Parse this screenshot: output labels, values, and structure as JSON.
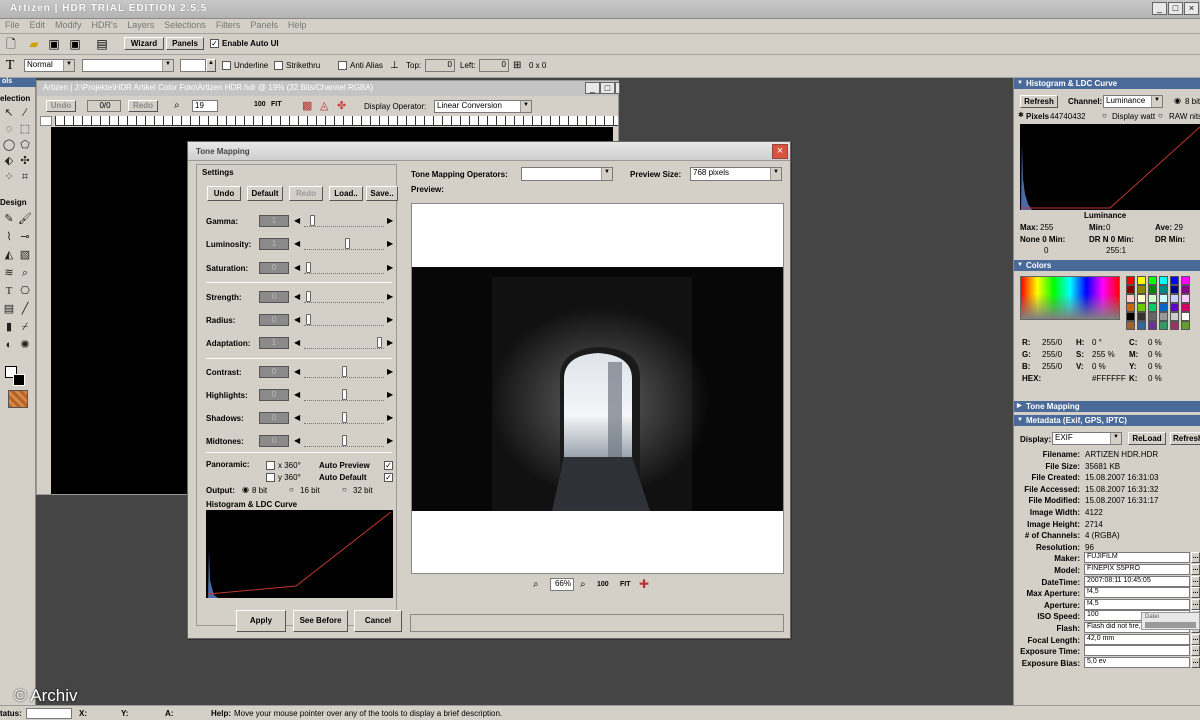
{
  "app": {
    "title": "Artizen | HDR TRIAL EDITION 2.5.5"
  },
  "menu": [
    "File",
    "Edit",
    "Modify",
    "HDR's",
    "Layers",
    "Selections",
    "Filters",
    "Panels",
    "Help"
  ],
  "toolbar1": {
    "wizard": "Wizard",
    "panels": "Panels",
    "enable_auto_ui": "Enable Auto UI"
  },
  "toolbar2": {
    "font_style": "Normal",
    "font_name": "",
    "font_size": "",
    "underline": "Underline",
    "strikethru": "Strikethru",
    "anti_alias": "Anti Alias",
    "top_label": "Top:",
    "top_value": "0",
    "left_label": "Left:",
    "left_value": "0",
    "size_readout": "0 x 0"
  },
  "toolbox": {
    "title_fragment": "ols",
    "selection": "election",
    "design": "Design"
  },
  "document": {
    "title": "Artizen | J:\\Projekte\\HDR Artikel Color Foto\\Artizen HDR.hdr @ 19% (32 Bits/Channel RGBA)",
    "undo": "Undo",
    "ratio": "0/0",
    "redo": "Redo",
    "zoom": "19",
    "btn_100": "100",
    "btn_fit": "FIT",
    "display_operator_label": "Display Operator:",
    "display_operator": "Linear Conversion"
  },
  "dialog": {
    "title": "Tone Mapping",
    "settings_label": "Settings",
    "buttons": {
      "undo": "Undo",
      "default": "Default",
      "redo": "Redo",
      "load": "Load..",
      "save": "Save.."
    },
    "sliders": [
      {
        "name": "Gamma:",
        "value": "1",
        "pos": 0.08
      },
      {
        "name": "Luminosity:",
        "value": "1",
        "pos": 0.55
      },
      {
        "name": "Saturation:",
        "value": "0",
        "pos": 0.03
      },
      {
        "name": "Strength:",
        "value": "0",
        "pos": 0.03
      },
      {
        "name": "Radius:",
        "value": "0",
        "pos": 0.03
      },
      {
        "name": "Adaptation:",
        "value": "1",
        "pos": 0.97
      },
      {
        "name": "Contrast:",
        "value": "0",
        "pos": 0.5
      },
      {
        "name": "Highlights:",
        "value": "0",
        "pos": 0.5
      },
      {
        "name": "Shadows:",
        "value": "0",
        "pos": 0.5
      },
      {
        "name": "Midtones:",
        "value": "0",
        "pos": 0.5
      }
    ],
    "panoramic_label": "Panoramic:",
    "x360": "x 360°",
    "y360": "y 360°",
    "auto_preview": "Auto Preview",
    "auto_default": "Auto Default",
    "output_label": "Output:",
    "out_8": "8 bit",
    "out_16": "16 bit",
    "out_32": "32 bit",
    "histogram_label": "Histogram & LDC Curve",
    "apply": "Apply",
    "see_before": "See Before",
    "cancel": "Cancel",
    "operators_label": "Tone Mapping Operators:",
    "operators_value": "",
    "preview_size_label": "Preview Size:",
    "preview_size": "768 pixels",
    "preview_label": "Preview:",
    "zoom_value": "66%",
    "btn_100": "100",
    "btn_fit": "FIT"
  },
  "histogram_panel": {
    "title": "Histogram & LDC Curve",
    "refresh": "Refresh",
    "channel_label": "Channel:",
    "channel": "Luminance",
    "bit": "8 bit",
    "pixels_label": "Pixels",
    "pixels": "44740432",
    "display_watt": "Display watt",
    "raw_nits": "RAW nits",
    "curve_label": "Luminance",
    "stats": [
      {
        "k": "Max:",
        "v": "255"
      },
      {
        "k": "Min:",
        "v": "0"
      },
      {
        "k": "Ave:",
        "v": "29"
      },
      {
        "k": "None 0 Min:",
        "v": "0"
      },
      {
        "k": "DR N 0 Min:",
        "v": "255:1"
      },
      {
        "k": "DR Min:",
        "v": ""
      }
    ]
  },
  "colors_panel": {
    "title": "Colors",
    "rows": [
      {
        "a": "R:",
        "av": "255/0",
        "b": "H:",
        "bv": "0 °",
        "c": "C:",
        "cv": "0 %"
      },
      {
        "a": "G:",
        "av": "255/0",
        "b": "S:",
        "bv": "255 %",
        "c": "M:",
        "cv": "0 %"
      },
      {
        "a": "B:",
        "av": "255/0",
        "b": "V:",
        "bv": "0 %",
        "c": "Y:",
        "cv": "0 %"
      },
      {
        "a": "HEX:",
        "av": "",
        "b": "",
        "bv": "#FFFFFF",
        "c": "K:",
        "cv": "0 %"
      }
    ]
  },
  "tone_panel": {
    "title": "Tone Mapping"
  },
  "meta_panel": {
    "title": "Metadata (Exif, GPS, IPTC)",
    "display_label": "Display:",
    "display": "EXIF",
    "reload": "ReLoad",
    "refresh": "Refresh",
    "rows": [
      {
        "k": "Filename:",
        "v": "ARTIZEN HDR.HDR",
        "box": false
      },
      {
        "k": "File Size:",
        "v": "35681 KB",
        "box": false
      },
      {
        "k": "File Created:",
        "v": "15.08.2007 16:31:03",
        "box": false
      },
      {
        "k": "File Accessed:",
        "v": "15.08.2007 16:31:32",
        "box": false
      },
      {
        "k": "File Modified:",
        "v": "15.08.2007 16:31:17",
        "box": false
      },
      {
        "k": "Image Width:",
        "v": "4122",
        "box": false
      },
      {
        "k": "Image Height:",
        "v": "2714",
        "box": false
      },
      {
        "k": "# of Channels:",
        "v": "4 (RGBA)",
        "box": false
      },
      {
        "k": "Resolution:",
        "v": "96",
        "box": false
      },
      {
        "k": "Maker:",
        "v": "FUJIFILM",
        "box": true
      },
      {
        "k": "Model:",
        "v": "FINEPIX S5PRO",
        "box": true
      },
      {
        "k": "DateTime:",
        "v": "2007:08:11 10:45:05",
        "box": true
      },
      {
        "k": "Max Aperture:",
        "v": "f4,5",
        "box": true
      },
      {
        "k": "Aperture:",
        "v": "f4,5",
        "box": true
      },
      {
        "k": "ISO Speed:",
        "v": "100",
        "box": true
      },
      {
        "k": "Flash:",
        "v": "Flash did not fire, compulsory",
        "box": true
      },
      {
        "k": "Focal Length:",
        "v": "42,0 mm",
        "box": true
      },
      {
        "k": "Exposure Time:",
        "v": "",
        "box": true
      },
      {
        "k": "Exposure Bias:",
        "v": "5,0 ev",
        "box": true
      }
    ],
    "tooltip": "Datei"
  },
  "status": {
    "status_label": "tatus:",
    "x": "X:",
    "y": "Y:",
    "a": "A:",
    "help_label": "Help:",
    "help_text": "Move your mouse pointer over any of the tools to display a brief description."
  },
  "watermark": "© Archiv"
}
